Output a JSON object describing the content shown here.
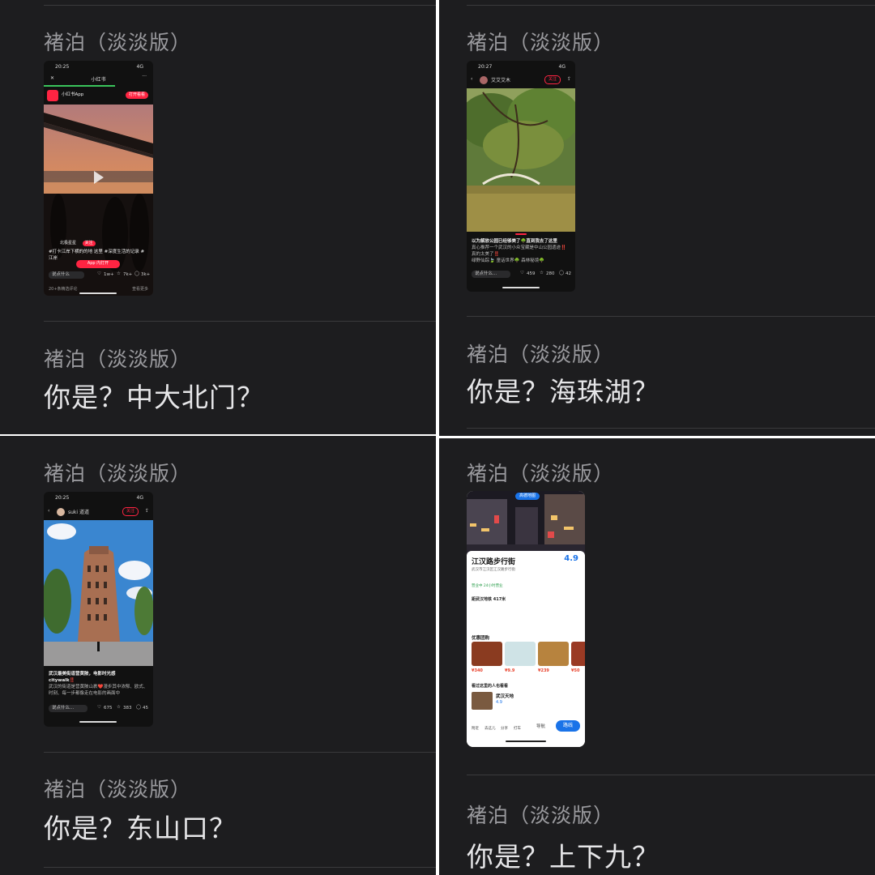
{
  "sender_name": "褚泊（淡淡版）",
  "messages": [
    {
      "text": "你是？中大北门？"
    },
    {
      "text": "你是？海珠湖？"
    },
    {
      "text": "你是？东山口？"
    },
    {
      "text": "你是？上下九？"
    }
  ],
  "shots": {
    "a": {
      "time": "20:25",
      "net": "4G",
      "header_title": "小红书",
      "app_name": "小红书App",
      "open_button": "打开看看",
      "author": "北极星星",
      "follow": "关注",
      "caption": "#打卡江岸下横的的地 这里 #深度生活的记录 #江岸",
      "open_app_button": "App 内打开",
      "comment_placeholder": "说点什么",
      "likes": "1w+",
      "stars": "7k+",
      "comments": "3k+",
      "footer": "20+条精选评论",
      "footer_right": "查看更多"
    },
    "b": {
      "time": "20:27",
      "net": "4G",
      "author": "艾艾艾木",
      "follow": "关注",
      "caption_line1": "以为解放公园已经够美了🌳直到我去了这里",
      "caption_line2": "真心推荐一个武汉的小众宝藏是中山公园遗迹‼️",
      "caption_line3": "真的太美了‼️",
      "caption_line4": "绿野仙踪🍃 童话世界🌳 森林秘境🌳",
      "comment_placeholder": "说点什么...",
      "likes": "459",
      "stars": "280",
      "comments": "42"
    },
    "c": {
      "time": "20:25",
      "net": "4G",
      "author": "suki 道道",
      "follow": "关注",
      "caption_line1": "武汉最美街道营黄陂，电影时光感",
      "caption_line2": "citywalk‼️",
      "caption_line3": "武汉的街道是营黄陂山裹❤️漫步其中浓郁、欧式、",
      "caption_line4": "时刻、每一步都像走在电影的画面中",
      "comment_placeholder": "说点什么...",
      "likes": "675",
      "stars": "383",
      "comments": "45"
    },
    "d": {
      "badge": "高德地图",
      "place_name": "江汉路步行街",
      "rating": "4.9",
      "address": "武汉市江汉区江汉路步行街",
      "status": "营业中 24小时营业",
      "metro": "距武汉地铁 417米",
      "deals_title": "优惠团购",
      "prices": [
        "¥340",
        "¥9.9",
        "¥239",
        "¥50"
      ],
      "nearby_title": "看过这里的人也看看",
      "nearby_name": "武汉天地",
      "nearby_rating": "4.9",
      "tabs": [
        "附近",
        "去这儿",
        "分享",
        "打车"
      ],
      "nav_label": "导航",
      "route_button": "路线"
    }
  },
  "colors": {
    "panel_bg": "#1d1d1f",
    "sender": "#9a9a9e",
    "message": "#e6e6e8",
    "accent_red": "#ff2442",
    "map_blue": "#1a73e8"
  }
}
